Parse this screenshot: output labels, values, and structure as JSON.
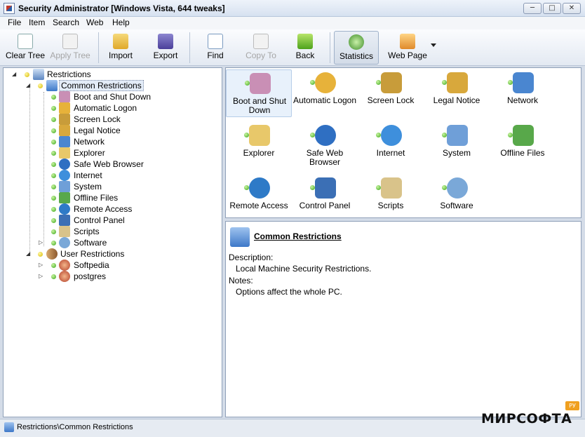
{
  "window": {
    "title": "Security Administrator [Windows Vista, 644 tweaks]"
  },
  "menu": {
    "items": [
      "File",
      "Item",
      "Search",
      "Web",
      "Help"
    ]
  },
  "toolbar": {
    "clear_tree": "Clear Tree",
    "apply_tree": "Apply Tree",
    "import": "Import",
    "export": "Export",
    "find": "Find",
    "copy_to": "Copy To",
    "back": "Back",
    "statistics": "Statistics",
    "web_page": "Web Page"
  },
  "tree": {
    "root": "Restrictions",
    "common": "Common Restrictions",
    "common_items": [
      "Boot and Shut Down",
      "Automatic Logon",
      "Screen Lock",
      "Legal Notice",
      "Network",
      "Explorer",
      "Safe Web Browser",
      "Internet",
      "System",
      "Offline Files",
      "Remote Access",
      "Control Panel",
      "Scripts",
      "Software"
    ],
    "user": "User Restrictions",
    "user_items": [
      "Softpedia",
      "postgres"
    ]
  },
  "icons_panel": {
    "items": [
      {
        "label": "Boot and Shut Down",
        "color": "#c98fb5"
      },
      {
        "label": "Automatic Logon",
        "color": "#e7b23a"
      },
      {
        "label": "Screen Lock",
        "color": "#c89c3a"
      },
      {
        "label": "Legal Notice",
        "color": "#d8a83c"
      },
      {
        "label": "Network",
        "color": "#4a86d0"
      },
      {
        "label": "Explorer",
        "color": "#e8c86a"
      },
      {
        "label": "Safe Web Browser",
        "color": "#2f6fc2"
      },
      {
        "label": "Internet",
        "color": "#3e8fdc"
      },
      {
        "label": "System",
        "color": "#6f9fd8"
      },
      {
        "label": "Offline Files",
        "color": "#58a84a"
      },
      {
        "label": "Remote Access",
        "color": "#2e7ac7"
      },
      {
        "label": "Control Panel",
        "color": "#3b6fb5"
      },
      {
        "label": "Scripts",
        "color": "#d9c38a"
      },
      {
        "label": "Software",
        "color": "#7aa8d8"
      }
    ]
  },
  "details": {
    "title": "Common Restrictions",
    "description_label": "Description:",
    "description": "Local Machine Security Restrictions.",
    "notes_label": "Notes:",
    "notes": "Options affect the whole PC."
  },
  "status": {
    "path": "Restrictions\\Common Restrictions"
  },
  "watermark": {
    "text": "МИРСОФТА",
    "badge": "РУ"
  }
}
